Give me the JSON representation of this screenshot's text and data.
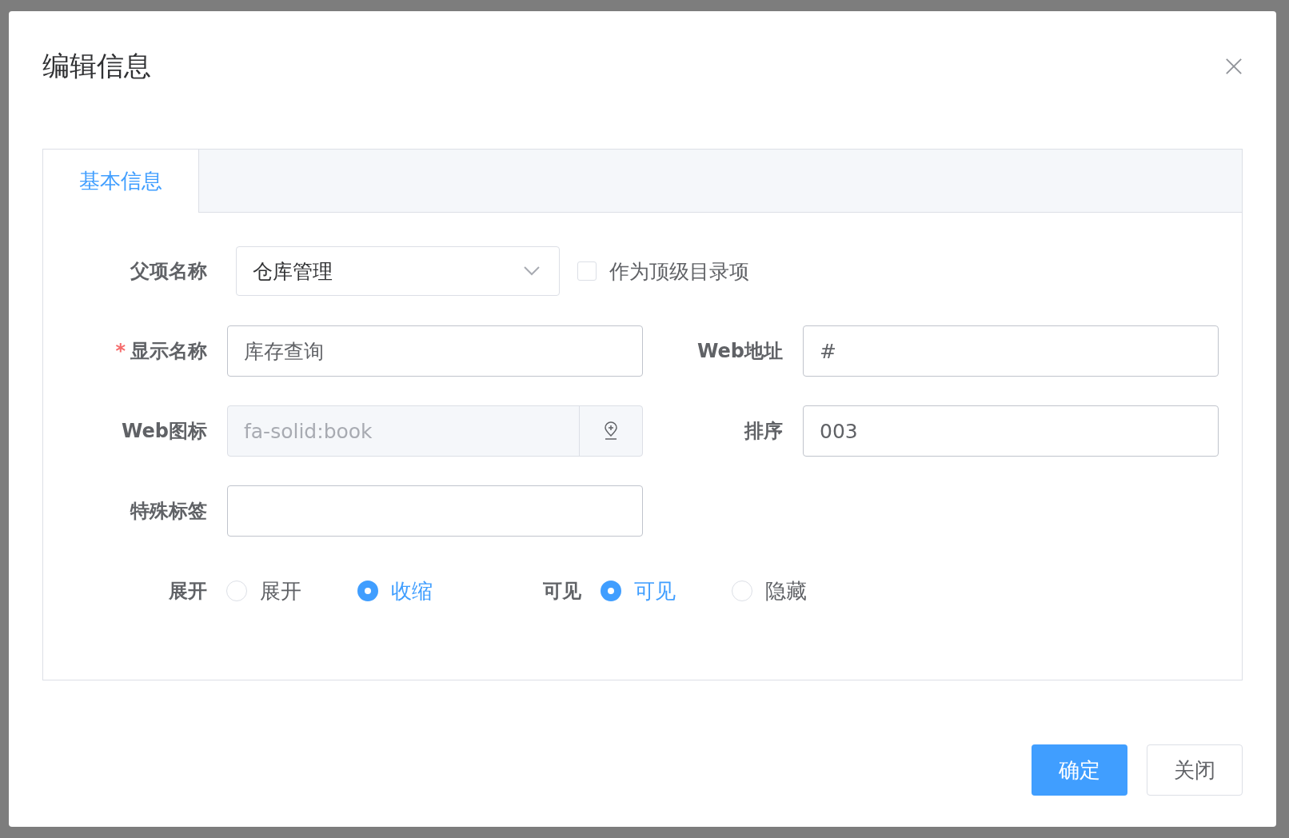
{
  "dialog": {
    "title": "编辑信息"
  },
  "tabs": [
    {
      "label": "基本信息",
      "selected": true
    }
  ],
  "parent": {
    "label": "父项名称",
    "value": "仓库管理",
    "checkbox": {
      "label": "作为顶级目录项",
      "checked": false
    }
  },
  "rows": [
    {
      "kind": "pair",
      "left": {
        "label": "显示名称",
        "required_mark": "*",
        "value": "库存查询",
        "disabled": false
      },
      "right": {
        "label": "Web地址",
        "value": "#",
        "disabled": false
      }
    },
    {
      "kind": "pair",
      "left": {
        "label": "Web图标",
        "value": "fa-solid:book",
        "disabled": true,
        "picker": true
      },
      "right": {
        "label": "排序",
        "value": "003",
        "disabled": false
      }
    },
    {
      "kind": "single",
      "left": {
        "label": "特殊标签",
        "disabled": false
      }
    }
  ],
  "radio_groups": [
    {
      "label": "展开",
      "options": [
        {
          "label": "展开",
          "selected": false
        },
        {
          "label": "收缩",
          "selected": true
        }
      ]
    },
    {
      "label": "可见",
      "options": [
        {
          "label": "可见",
          "selected": true
        },
        {
          "label": "隐藏",
          "selected": false
        }
      ]
    }
  ],
  "buttons": [
    {
      "label": "确定",
      "kind": "primary"
    },
    {
      "label": "关闭",
      "kind": "default"
    }
  ]
}
